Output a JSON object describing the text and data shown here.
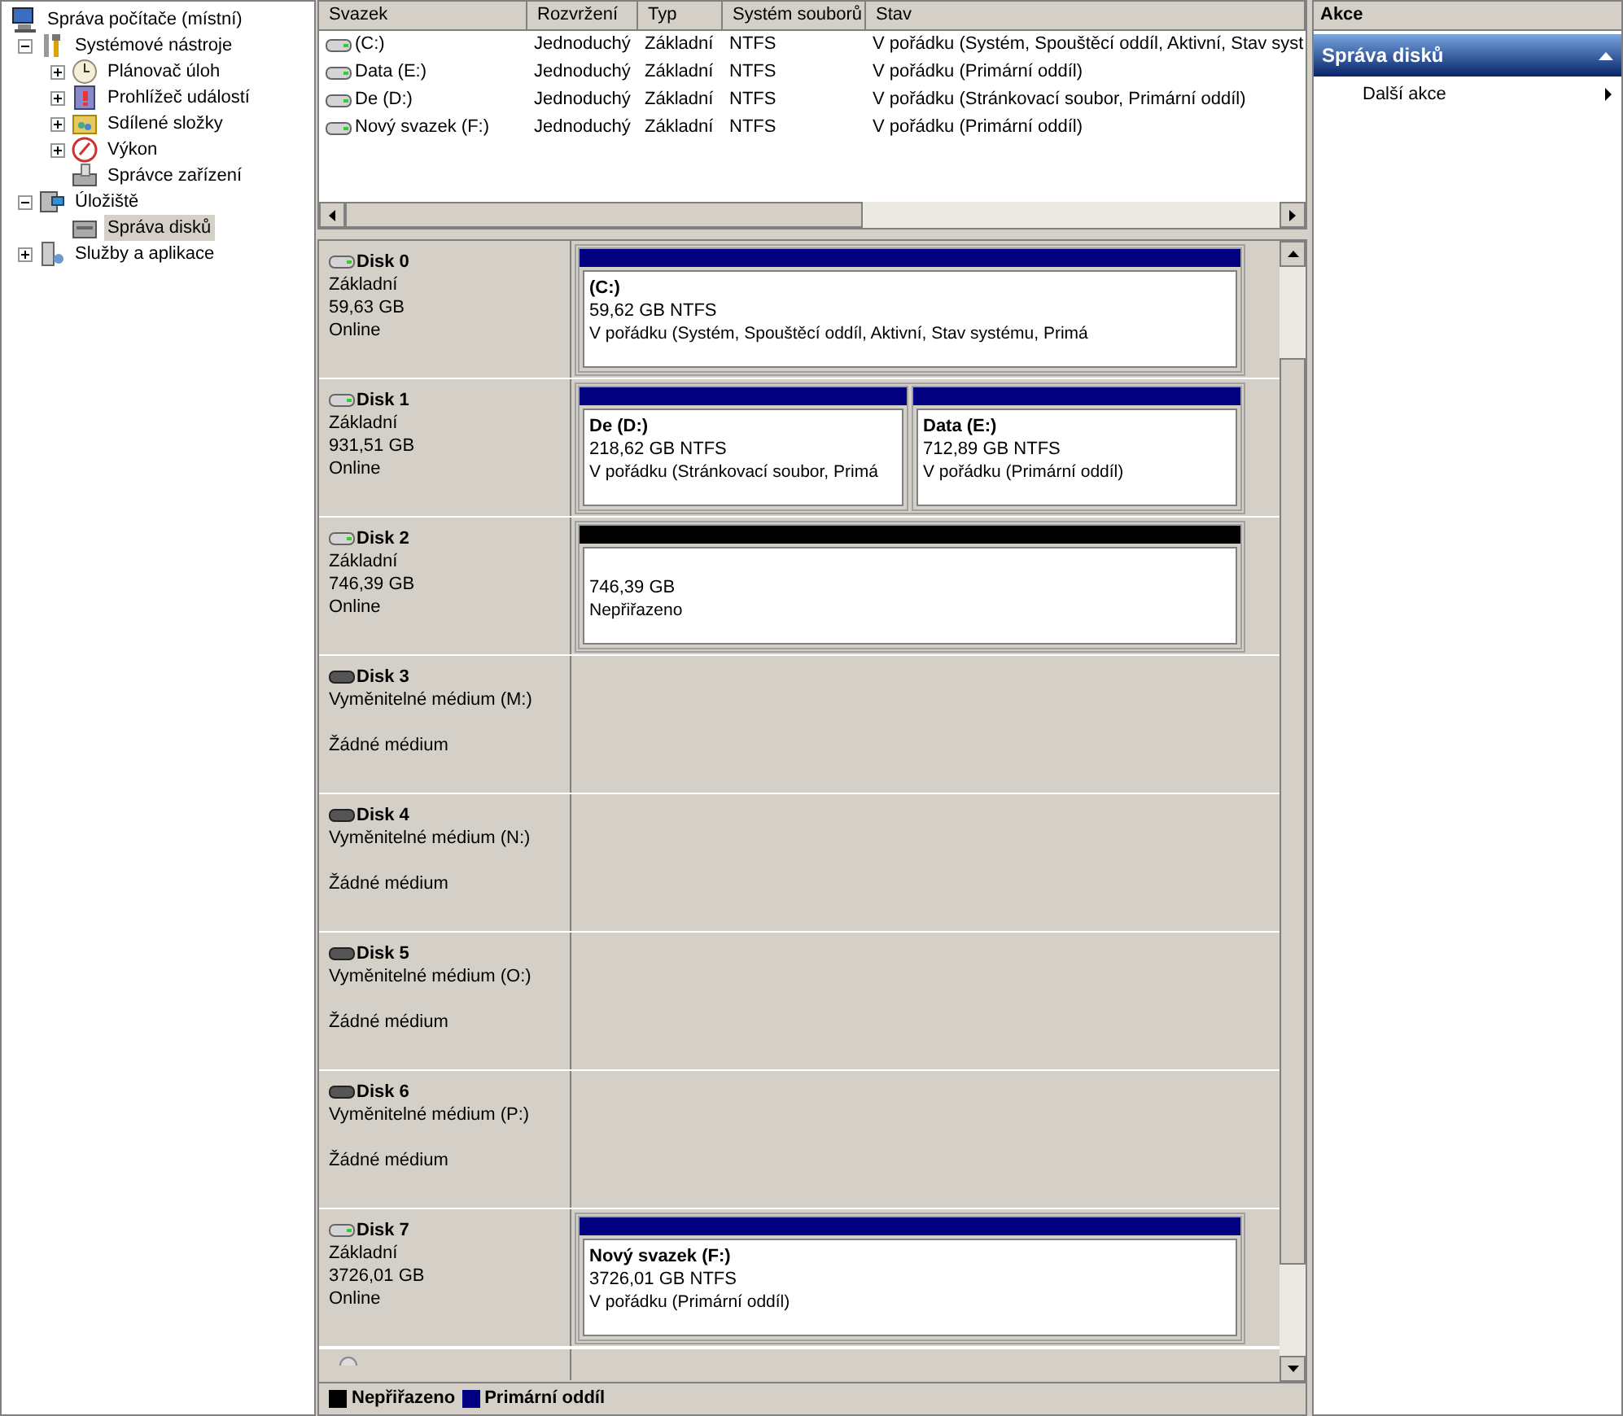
{
  "tree": [
    {
      "label": "Správa počítače (místní)",
      "selected": false,
      "children": [
        {
          "label": "Systémové nástroje",
          "expanded": true,
          "selected": false,
          "children": [
            {
              "label": "Plánovač úloh",
              "expanded": false,
              "selected": false
            },
            {
              "label": "Prohlížeč událostí",
              "expanded": false,
              "selected": false
            },
            {
              "label": "Sdílené složky",
              "expanded": false,
              "selected": false
            },
            {
              "label": "Výkon",
              "expanded": false,
              "selected": false
            },
            {
              "label": "Správce zařízení",
              "selected": false
            }
          ]
        },
        {
          "label": "Úložiště",
          "expanded": true,
          "selected": false,
          "children": [
            {
              "label": "Správa disků",
              "selected": true
            }
          ]
        },
        {
          "label": "Služby a aplikace",
          "expanded": false,
          "selected": false
        }
      ]
    }
  ],
  "volume_table": {
    "columns": [
      "Svazek",
      "Rozvržení",
      "Typ",
      "Systém souborů",
      "Stav"
    ],
    "rows": [
      [
        "(C:)",
        "Jednoduchý",
        "Základní",
        "NTFS",
        "V pořádku (Systém, Spouštěcí oddíl, Aktivní, Stav syst"
      ],
      [
        "Data (E:)",
        "Jednoduchý",
        "Základní",
        "NTFS",
        "V pořádku (Primární oddíl)"
      ],
      [
        "De (D:)",
        "Jednoduchý",
        "Základní",
        "NTFS",
        "V pořádku (Stránkovací soubor, Primární oddíl)"
      ],
      [
        "Nový svazek (F:)",
        "Jednoduchý",
        "Základní",
        "NTFS",
        "V pořádku (Primární oddíl)"
      ]
    ]
  },
  "disks": [
    {
      "name": "Disk 0",
      "kind": "basic",
      "type": "Základní",
      "size": "59,63 GB",
      "status": "Online",
      "partitions": [
        {
          "kind": "primary",
          "title": "(C:)",
          "size": "59,62 GB NTFS",
          "status": "V pořádku (Systém, Spouštěcí oddíl, Aktivní, Stav systému, Primá"
        }
      ]
    },
    {
      "name": "Disk 1",
      "kind": "basic",
      "type": "Základní",
      "size": "931,51 GB",
      "status": "Online",
      "partitions": [
        {
          "kind": "primary",
          "title": "De  (D:)",
          "size": "218,62 GB NTFS",
          "status": "V pořádku (Stránkovací soubor, Primá"
        },
        {
          "kind": "primary",
          "title": "Data  (E:)",
          "size": "712,89 GB NTFS",
          "status": "V pořádku (Primární oddíl)"
        }
      ]
    },
    {
      "name": "Disk 2",
      "kind": "basic",
      "type": "Základní",
      "size": "746,39 GB",
      "status": "Online",
      "partitions": [
        {
          "kind": "unallocated",
          "size": "746,39 GB",
          "status": "Nepřiřazeno"
        }
      ]
    },
    {
      "name": "Disk 3",
      "kind": "removable",
      "type": "Vyměnitelné médium (M:)",
      "status": "Žádné médium"
    },
    {
      "name": "Disk 4",
      "kind": "removable",
      "type": "Vyměnitelné médium (N:)",
      "status": "Žádné médium"
    },
    {
      "name": "Disk 5",
      "kind": "removable",
      "type": "Vyměnitelné médium (O:)",
      "status": "Žádné médium"
    },
    {
      "name": "Disk 6",
      "kind": "removable",
      "type": "Vyměnitelné médium (P:)",
      "status": "Žádné médium"
    },
    {
      "name": "Disk 7",
      "kind": "basic",
      "type": "Základní",
      "size": "3726,01 GB",
      "status": "Online",
      "partitions": [
        {
          "kind": "primary",
          "title": "Nový svazek  (F:)",
          "size": "3726,01 GB NTFS",
          "status": "V pořádku (Primární oddíl)"
        }
      ]
    },
    {
      "kind": "cdrom"
    }
  ],
  "legend": [
    {
      "label": "Nepřiřazeno",
      "color": "#000000"
    },
    {
      "label": "Primární oddíl",
      "color": "#000080"
    }
  ],
  "actions": {
    "title": "Akce",
    "section": {
      "label": "Správa disků",
      "expanded": true,
      "items": [
        "Další akce"
      ]
    }
  }
}
